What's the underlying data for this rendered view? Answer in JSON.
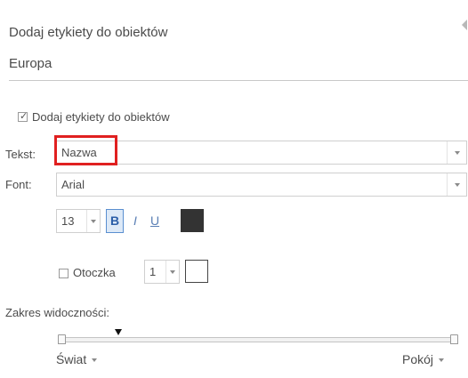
{
  "header": {
    "title": "Dodaj etykiety do obiektów",
    "layer_name": "Europa"
  },
  "labels_toggle": {
    "label": "Dodaj etykiety do obiektów",
    "checked": true
  },
  "text_field": {
    "label": "Tekst:",
    "value": "Nazwa"
  },
  "font_field": {
    "label": "Font:",
    "value": "Arial"
  },
  "format": {
    "size": "13",
    "bold": "B",
    "italic": "I",
    "underline": "U",
    "color": "#333333"
  },
  "halo": {
    "label": "Otoczka",
    "checked": false,
    "size": "1",
    "color": "#ffffff"
  },
  "visibility": {
    "label": "Zakres widoczności:",
    "min_label": "Świat",
    "max_label": "Pokój"
  },
  "colors": {
    "highlight": "#e02020",
    "accent": "#5a8fd0"
  }
}
